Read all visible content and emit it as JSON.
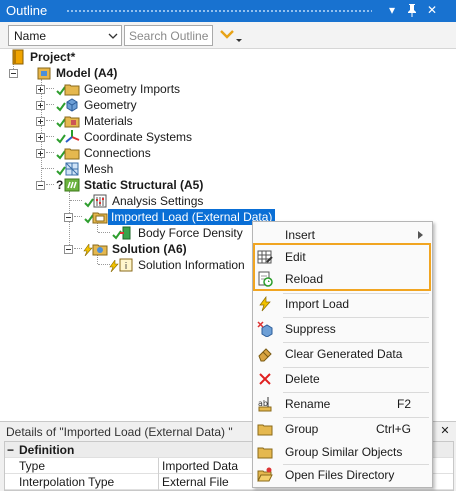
{
  "window": {
    "title": "Outline"
  },
  "toolbar": {
    "name_combo_value": "Name",
    "search_placeholder": "Search Outline"
  },
  "tree": {
    "project": "Project*",
    "model": "Model (A4)",
    "geometry_imports": "Geometry Imports",
    "geometry": "Geometry",
    "materials": "Materials",
    "coordinate_systems": "Coordinate Systems",
    "connections": "Connections",
    "mesh": "Mesh",
    "static_structural": "Static Structural (A5)",
    "analysis_settings": "Analysis Settings",
    "imported_load": "Imported Load (External Data)",
    "body_force_density": "Body Force Density",
    "solution": "Solution (A6)",
    "solution_information": "Solution Information"
  },
  "details": {
    "header": "Details of \"Imported Load (External Data) \"",
    "section": "Definition",
    "rows": [
      {
        "label": "Type",
        "value": "Imported Data"
      },
      {
        "label": "Interpolation Type",
        "value": "External File"
      }
    ]
  },
  "context_menu": {
    "items": [
      {
        "label": "Insert",
        "icon": "none",
        "has_submenu": true
      },
      {
        "label": "Edit",
        "icon": "table-edit-icon"
      },
      {
        "label": "Reload",
        "icon": "reload-icon"
      },
      {
        "label": "Import Load",
        "icon": "lightning-icon"
      },
      {
        "label": "Suppress",
        "icon": "suppress-icon"
      },
      {
        "label": "Clear Generated Data",
        "icon": "eraser-icon"
      },
      {
        "label": "Delete",
        "icon": "delete-x-icon"
      },
      {
        "label": "Rename",
        "icon": "rename-icon",
        "shortcut": "F2"
      },
      {
        "label": "Group",
        "icon": "folder-icon",
        "shortcut": "Ctrl+G"
      },
      {
        "label": "Group Similar Objects",
        "icon": "folder-icon"
      },
      {
        "label": "Open Files Directory",
        "icon": "open-folder-icon"
      }
    ]
  },
  "colors": {
    "title_bar": "#1872d0",
    "selection": "#0a6fd6",
    "highlight_box": "#f1a521",
    "check": "#2e9e2e"
  }
}
